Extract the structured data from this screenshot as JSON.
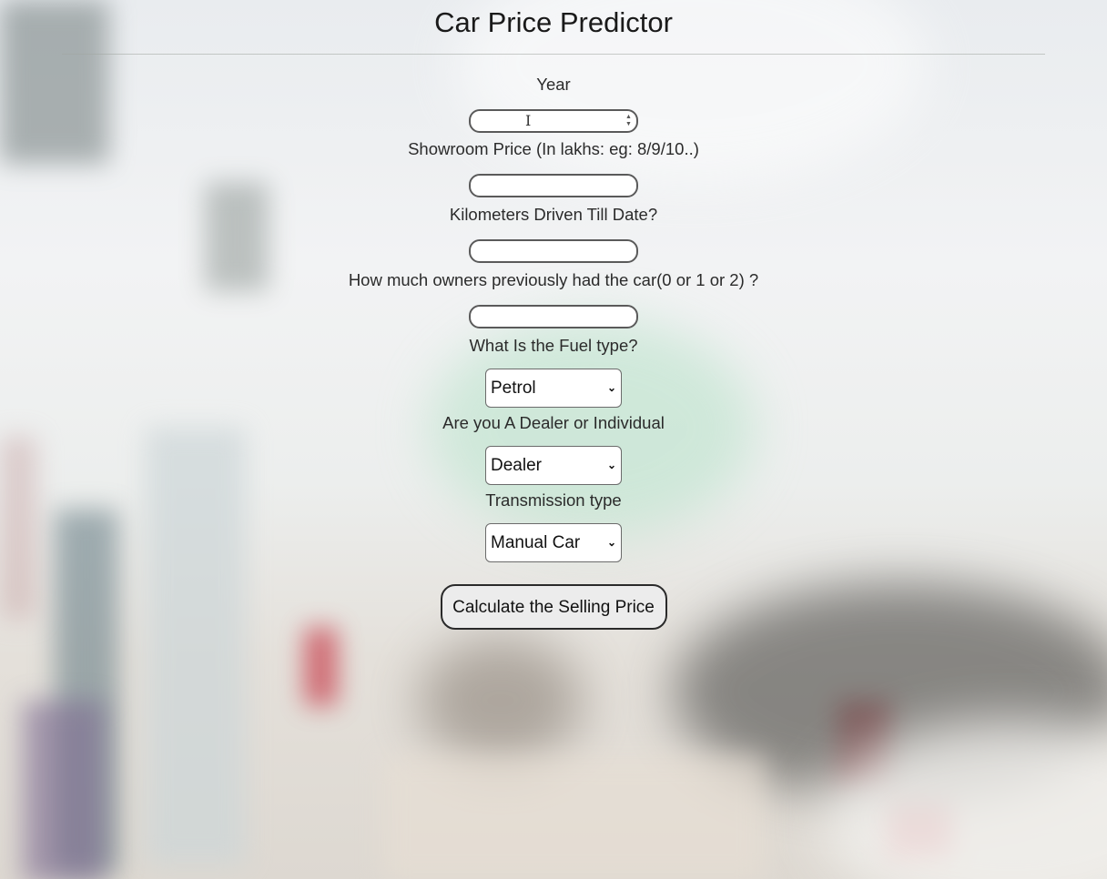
{
  "page": {
    "title": "Car Price Predictor"
  },
  "form": {
    "year": {
      "label": "Year",
      "value": ""
    },
    "showroom_price": {
      "label": "Showroom Price (In lakhs: eg: 8/9/10..)",
      "value": ""
    },
    "kms_driven": {
      "label": "Kilometers Driven Till Date?",
      "value": ""
    },
    "owners": {
      "label": "How much owners previously had the car(0 or 1 or 2) ?",
      "value": ""
    },
    "fuel_type": {
      "label": "What Is the Fuel type?",
      "selected": "Petrol"
    },
    "seller_type": {
      "label": "Are you A Dealer or Individual",
      "selected": "Dealer"
    },
    "transmission": {
      "label": "Transmission type",
      "selected": "Manual Car"
    },
    "submit_label": "Calculate the Selling Price"
  },
  "icons": {
    "spinner": "number-spinner-icon",
    "cursor": "text-cursor-icon",
    "dropdown": "chevron-down-icon"
  }
}
